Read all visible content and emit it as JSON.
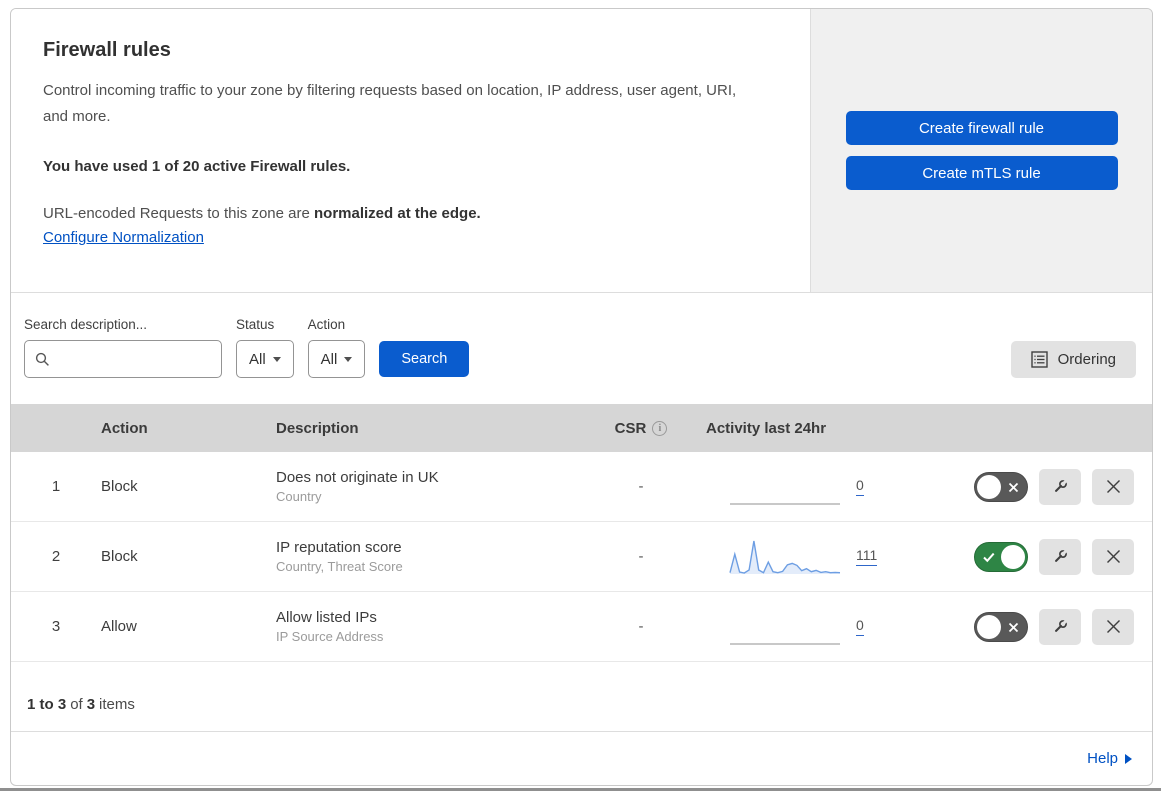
{
  "header": {
    "title": "Firewall rules",
    "description": "Control incoming traffic to your zone by filtering requests based on location, IP address, user agent, URI, and more.",
    "usage_note": "You have used 1 of 20 active Firewall rules.",
    "normalization_text": "URL-encoded Requests to this zone are ",
    "normalization_bold": "normalized at the edge.",
    "normalization_link": "Configure Normalization",
    "create_firewall_rule_label": "Create firewall rule",
    "create_mtls_rule_label": "Create mTLS rule"
  },
  "filters": {
    "search_label": "Search description...",
    "status_label": "Status",
    "status_value": "All",
    "action_label": "Action",
    "action_value": "All",
    "search_button_label": "Search",
    "ordering_button_label": "Ordering"
  },
  "table": {
    "columns": {
      "action": "Action",
      "description": "Description",
      "csr": "CSR",
      "csr_info": "i",
      "activity": "Activity last 24hr"
    },
    "rules": [
      {
        "index": "1",
        "action": "Block",
        "description": "Does not originate in UK",
        "fields": "Country",
        "csr": "-",
        "activity_count": "0",
        "enabled": false,
        "sparkline": []
      },
      {
        "index": "2",
        "action": "Block",
        "description": "IP reputation score",
        "fields": "Country, Threat Score",
        "csr": "-",
        "activity_count": "111",
        "enabled": true,
        "sparkline": [
          0.04,
          0.6,
          0.06,
          0.03,
          0.12,
          1.0,
          0.12,
          0.04,
          0.36,
          0.07,
          0.04,
          0.08,
          0.28,
          0.32,
          0.26,
          0.1,
          0.16,
          0.07,
          0.11,
          0.05,
          0.07,
          0.04,
          0.05,
          0.04
        ]
      },
      {
        "index": "3",
        "action": "Allow",
        "description": "Allow listed IPs",
        "fields": "IP Source Address",
        "csr": "-",
        "activity_count": "0",
        "enabled": false,
        "sparkline": []
      }
    ],
    "footer": {
      "range": "1 to 3",
      "of": "of",
      "total": "3",
      "items": "items"
    }
  },
  "help": {
    "label": "Help"
  },
  "colors": {
    "button_blue": "#0a5cce",
    "link_blue": "#0051c3",
    "toggle_green": "#2e8545",
    "toggle_gray": "#595959",
    "spark_blue": "#6d9ee3",
    "spark_fill": "#e3ecfa",
    "spark_flat": "#b5b5b5",
    "header_gray": "#d6d6d6"
  }
}
